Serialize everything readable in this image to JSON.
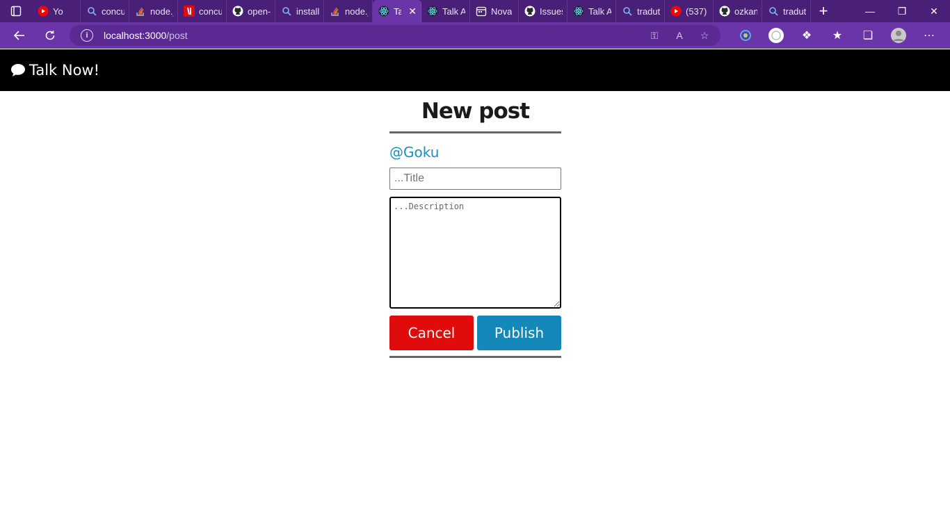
{
  "browser": {
    "tabs": [
      {
        "label": "Yo",
        "icon": "youtube-icon"
      },
      {
        "label": "concu",
        "icon": "search-icon"
      },
      {
        "label": "node.j",
        "icon": "stackoverflow-icon"
      },
      {
        "label": "concu",
        "icon": "netflix-icon"
      },
      {
        "label": "open-",
        "icon": "github-icon"
      },
      {
        "label": "install",
        "icon": "search-icon"
      },
      {
        "label": "node.j",
        "icon": "stackoverflow-icon"
      },
      {
        "label": "Ta",
        "icon": "react-icon",
        "active": true
      },
      {
        "label": "Talk A",
        "icon": "react-icon"
      },
      {
        "label": "Nova",
        "icon": "calendar-icon"
      },
      {
        "label": "Issues",
        "icon": "github-icon"
      },
      {
        "label": "Talk A",
        "icon": "react-icon"
      },
      {
        "label": "tradut",
        "icon": "search-icon"
      },
      {
        "label": "(537)",
        "icon": "youtube-icon"
      },
      {
        "label": "ozkan",
        "icon": "github-icon"
      },
      {
        "label": "tradut",
        "icon": "search-icon"
      }
    ],
    "url_host": "localhost:3000",
    "url_path": "/post"
  },
  "app": {
    "brand": "Talk Now!"
  },
  "form": {
    "heading": "New post",
    "username": "@Goku",
    "title_placeholder": "...Title",
    "description_placeholder": "...Description",
    "cancel_label": "Cancel",
    "publish_label": "Publish"
  },
  "colors": {
    "tabstrip": "#4a1f78",
    "toolbar": "#6a35a8",
    "header": "#000000",
    "cancel": "#e00b0b",
    "publish": "#1488b8",
    "username": "#1a8fbe"
  }
}
